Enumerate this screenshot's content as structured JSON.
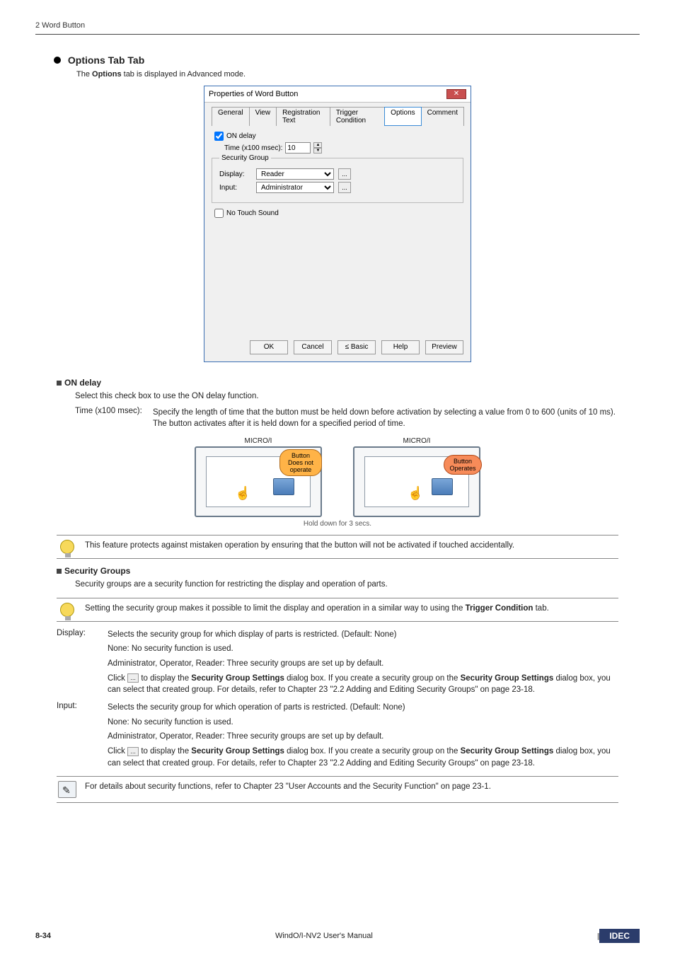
{
  "header": {
    "section_title": "2 Word Button"
  },
  "section": {
    "title": "Options Tab",
    "intro_pre": "The ",
    "intro_bold": "Options",
    "intro_post": " tab is displayed in Advanced mode."
  },
  "dialog": {
    "title": "Properties of Word Button",
    "tabs": [
      "General",
      "View",
      "Registration Text",
      "Trigger Condition",
      "Options",
      "Comment"
    ],
    "on_delay_label": "ON delay",
    "time_label": "Time (x100 msec):",
    "time_value": "10",
    "security_group_title": "Security Group",
    "display_label": "Display:",
    "display_value": "Reader",
    "input_label": "Input:",
    "input_value": "Administrator",
    "no_touch_sound": "No Touch Sound",
    "buttons": {
      "ok": "OK",
      "cancel": "Cancel",
      "basic": "≤ Basic",
      "help": "Help",
      "preview": "Preview"
    }
  },
  "on_delay": {
    "heading": "ON delay",
    "desc": "Select this check box to use the ON delay function.",
    "time_key": "Time (x100 msec):",
    "time_val1": "Specify the length of time that the button must be held down before activation by selecting a value from 0 to 600 (units of 10 ms).",
    "time_val2": "The button activates after it is held down for a specified period of time.",
    "micro_label": "MICRO/I",
    "bubble_left": "Button Does not operate",
    "bubble_right": "Button Operates",
    "hold_text": "Hold down for 3 secs.",
    "note": "This feature protects against mistaken operation by ensuring that the button will not be activated if touched accidentally."
  },
  "security": {
    "heading": "Security Groups",
    "desc": "Security groups are a security function for restricting the display and operation of parts.",
    "note_pre": "Setting the security group makes it possible to limit the display and operation in a similar way to using the ",
    "note_bold": "Trigger Condition",
    "note_post": " tab.",
    "display_key": "Display:",
    "display_val": "Selects the security group for which display of parts is restricted. (Default: None)",
    "none_line": "None: No security function is used.",
    "admin_line": "Administrator, Operator, Reader: Three security groups are set up by default.",
    "click_pre": "Click ",
    "click_mid": " to display the ",
    "sgs_bold": "Security Group Settings",
    "click_post1": " dialog box. If you create a security group on the ",
    "click_post2": " dialog box, you can select that created group. For details, refer to Chapter 23 \"2.2 Adding and Editing Security Groups\" on page 23-18.",
    "input_key": "Input:",
    "input_val": "Selects the security group for which operation of parts is restricted. (Default: None)",
    "ref_note": "For details about security functions, refer to Chapter 23 \"User Accounts and the Security Function\" on page 23-1."
  },
  "footer": {
    "page_num": "8-34",
    "manual": "WindO/I-NV2 User's Manual",
    "brand": "IDEC"
  }
}
